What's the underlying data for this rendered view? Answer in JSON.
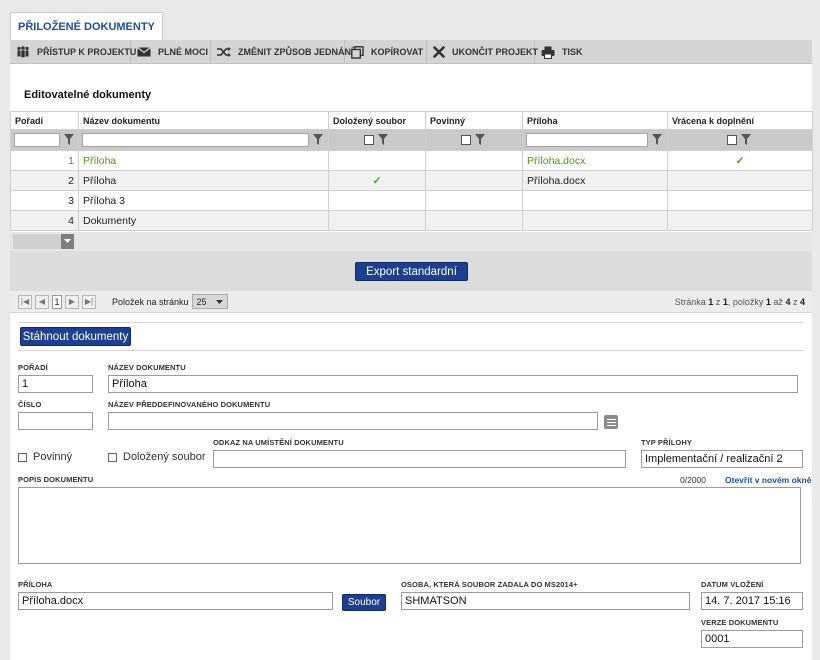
{
  "main_tab": "PŘILOŽENÉ DOKUMENTY",
  "toolbar": [
    {
      "label": "PŘÍSTUP K PROJEKTU",
      "icon": "people-icon"
    },
    {
      "label": "PLNÉ MOCI",
      "icon": "envelope-icon"
    },
    {
      "label": "ZMĚNIT ZPŮSOB JEDNÁNÍ",
      "icon": "shuffle-icon"
    },
    {
      "label": "KOPÍROVAT",
      "icon": "copy-icon"
    },
    {
      "label": "UKONČIT PROJEKT",
      "icon": "close-icon"
    },
    {
      "label": "TISK",
      "icon": "printer-icon"
    }
  ],
  "section_title": "Editovatelné dokumenty",
  "table": {
    "columns": [
      "Pořadí",
      "Název dokumentu",
      "Doložený soubor",
      "Povinný",
      "Příloha",
      "Vrácena k doplnění"
    ],
    "rows": [
      {
        "poradi": "1",
        "nazev": "Příloha",
        "dolozeny": "",
        "povinny": "",
        "priloha": "Příloha.docx",
        "vracena": "✓"
      },
      {
        "poradi": "2",
        "nazev": "Příloha",
        "dolozeny": "✓",
        "povinny": "",
        "priloha": "Příloha.docx",
        "vracena": ""
      },
      {
        "poradi": "3",
        "nazev": "Příloha 3",
        "dolozeny": "",
        "povinny": "",
        "priloha": "",
        "vracena": ""
      },
      {
        "poradi": "4",
        "nazev": "Dokumenty",
        "dolozeny": "",
        "povinny": "",
        "priloha": "",
        "vracena": ""
      }
    ]
  },
  "export_button": "Export standardní",
  "pager": {
    "current_page": "1",
    "per_page_label": "Položek na stránku",
    "per_page_value": "25",
    "info_prefix": "Stránka",
    "page": "1",
    "of_label": "z",
    "pages": "1",
    "items_label": ", položky",
    "from": "1",
    "to_label": "až",
    "to": "4",
    "to_label2": "z",
    "total": "4"
  },
  "download_button": "Stáhnout dokumenty",
  "form": {
    "poradi_label": "POŘADÍ",
    "poradi_value": "1",
    "nazev_label": "NÁZEV DOKUMENTU",
    "nazev_value": "Příloha",
    "cislo_label": "ČÍSLO",
    "cislo_value": "",
    "predef_label": "NÁZEV PŘEDDEFINOVANÉHO DOKUMENTU",
    "predef_value": "",
    "povinny_label": "Povinný",
    "dolozeny_label": "Doložený soubor",
    "odkaz_label": "ODKAZ NA UMÍSTĚNÍ DOKUMENTU",
    "odkaz_value": "",
    "typ_label": "TYP PŘÍLOHY",
    "typ_value": "Implementační / realizační 2",
    "popis_label": "POPIS DOKUMENTU",
    "popis_counter": "0/2000",
    "popis_link": "Otevřít v novém okně",
    "popis_value": "",
    "priloha_label": "PŘÍLOHA",
    "priloha_value": "Příloha.docx",
    "soubor_button": "Soubor",
    "osoba_label": "OSOBA, KTERÁ SOUBOR ZADALA DO MS2014+",
    "osoba_value": "SHMATSON",
    "datum_label": "DATUM VLOŽENÍ",
    "datum_value": "14. 7. 2017 15:16",
    "verze_label": "VERZE DOKUMENTU",
    "verze_value": "0001"
  },
  "colors": {
    "accent": "#1f4ea1",
    "button": "#1e3f8f",
    "green_text": "#4d9a12",
    "check": "#3aa520"
  }
}
